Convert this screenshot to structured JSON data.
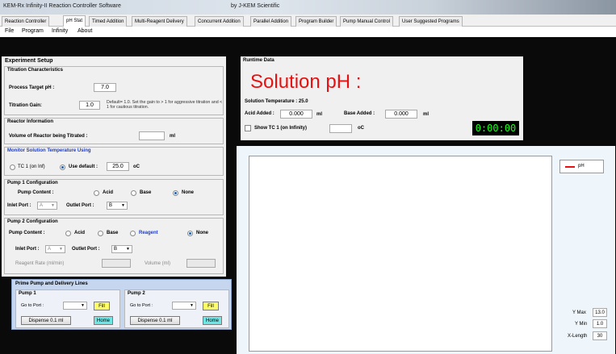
{
  "window": {
    "title": "KEM-Rx Infinity-II Reaction Controller Software",
    "center_title": "by J-KEM Scientific"
  },
  "tabs": [
    {
      "label": "Reaction Controller",
      "active": false
    },
    {
      "label": "pH Stat",
      "active": true
    },
    {
      "label": "Timed Addition",
      "active": false
    },
    {
      "label": "Multi-Reagent Delivery",
      "active": false
    },
    {
      "label": "Concurrent Addition",
      "active": false
    },
    {
      "label": "Parallel Addition",
      "active": false
    },
    {
      "label": "Program Builder",
      "active": false
    },
    {
      "label": "Pump Manual Control",
      "active": false
    },
    {
      "label": "User Suggested Programs",
      "active": false
    }
  ],
  "menu": [
    "File",
    "Program",
    "Infinity",
    "About"
  ],
  "setup": {
    "title": "Experiment Setup",
    "titration": {
      "title": "Titration Characteristics",
      "target_label": "Process Target pH :",
      "target_value": "7.0",
      "gain_label": "Titration Gain:",
      "gain_value": "1.0",
      "gain_hint": "Default= 1.0. Set the gain to > 1 for aggressive titration and < 1 for cautious titration."
    },
    "reactor": {
      "title": "Reactor Information",
      "volume_label": "Volume of Reactor being Titrated :",
      "volume_value": "",
      "volume_unit": "ml"
    },
    "temperature": {
      "title": "Monitor Solution Temperature Using",
      "option1": "TC 1 (on Inf)",
      "option2": "Use default :",
      "default_value": "25.0",
      "unit": "oC"
    },
    "pump1": {
      "title": "Pump 1 Configuration",
      "content_label": "Pump Content :",
      "options": [
        "Acid",
        "Base",
        "None"
      ],
      "selected": "None",
      "inlet_label": "Inlet Port :",
      "inlet_value": "A",
      "outlet_label": "Outlet Port :",
      "outlet_value": "B"
    },
    "pump2": {
      "title": "Pump 2 Configuration",
      "content_label": "Pump Content :",
      "options": [
        "Acid",
        "Base",
        "Reagent",
        "None"
      ],
      "selected": "None",
      "inlet_label": "Inlet Port :",
      "inlet_value": "A",
      "outlet_label": "Outlet Port :",
      "outlet_value": "B",
      "rate_label": "Reagent Rate (ml/min)",
      "volume_label": "Volume (ml)"
    }
  },
  "prime": {
    "title": "Prime Pump and Delivery Lines",
    "pump1": {
      "title": "Pump 1",
      "goto": "Go to Port :",
      "fill": "Fill",
      "dispense": "Dispense 0.1 ml",
      "home": "Home"
    },
    "pump2": {
      "title": "Pump 2",
      "goto": "Go to Port :",
      "fill": "Fill",
      "dispense": "Dispense 0.1 ml",
      "home": "Home"
    }
  },
  "runtime": {
    "title": "Runtime Data",
    "ph_heading": "Solution pH :",
    "temp_label": "Solution Temperature : 25.0",
    "acid_label": "Acid Added :",
    "acid_value": "0.000",
    "acid_unit": "ml",
    "base_label": "Base Added :",
    "base_value": "0.000",
    "base_unit": "ml",
    "show_tc_label": "Show TC 1 (on Infinity)",
    "show_tc_unit": "oC",
    "timer": "0:00:00"
  },
  "chart": {
    "legend": "pH",
    "ymax_label": "Y Max",
    "ymax_value": "13.0",
    "ymin_label": "Y Min",
    "ymin_value": "1.0",
    "xlength_label": "X-Length",
    "xlength_value": "30"
  },
  "colors": {
    "accent_red": "#e81010",
    "timer_green": "#1aff1a",
    "prime_bg": "#c6d6ef"
  }
}
